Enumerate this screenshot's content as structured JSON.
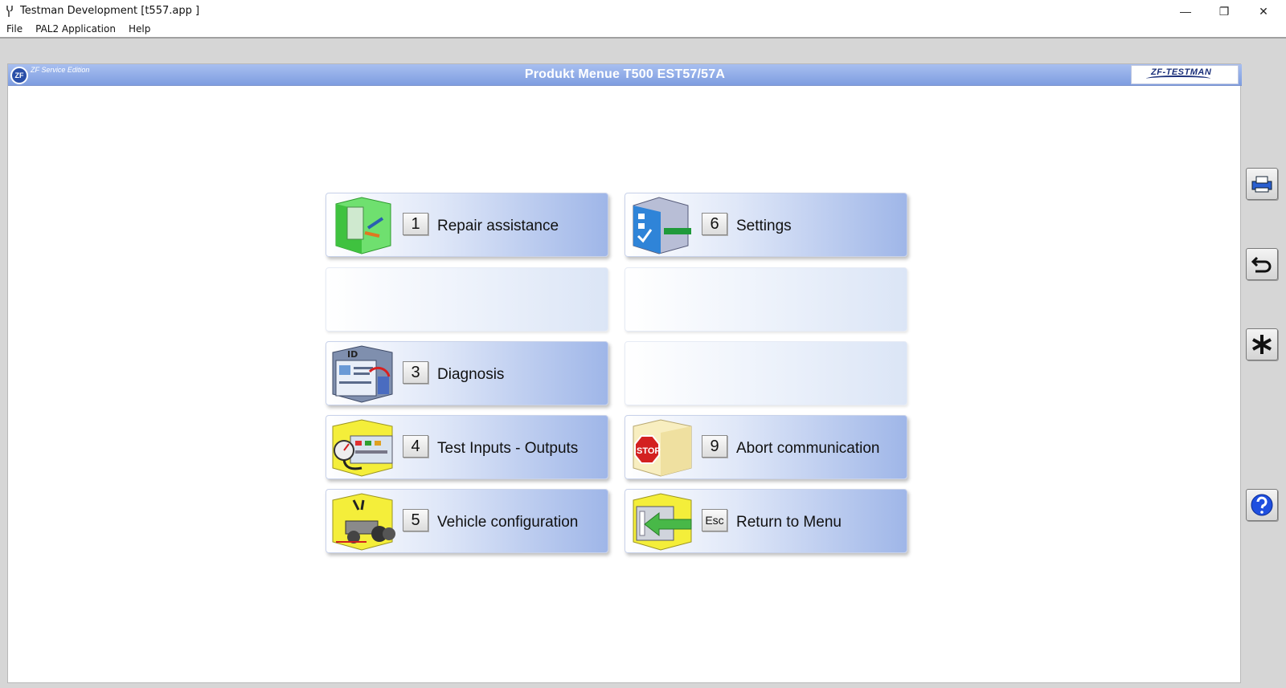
{
  "window": {
    "title": "Testman Development [t557.app     ]",
    "icon": "tool-icon",
    "controls": {
      "minimize": "—",
      "maximize": "❐",
      "close": "✕"
    }
  },
  "menu": {
    "items": [
      "File",
      "PAL2 Application",
      "Help"
    ]
  },
  "header": {
    "badge": "ZF",
    "edition": "ZF Service Edition",
    "title": "Produkt Menue T500 EST57/57A",
    "logo": "ZF-TESTMAN"
  },
  "tiles": [
    {
      "key": "1",
      "label": "Repair assistance",
      "icon": "repair-assistance-icon"
    },
    {
      "key": "6",
      "label": "Settings",
      "icon": "settings-icon"
    },
    {
      "key": "3",
      "label": "Diagnosis",
      "icon": "diagnosis-icon"
    },
    {
      "key": "4",
      "label": "Test Inputs - Outputs",
      "icon": "test-io-icon"
    },
    {
      "key": "9",
      "label": "Abort communication",
      "icon": "stop-icon"
    },
    {
      "key": "5",
      "label": "Vehicle configuration",
      "icon": "vehicle-configuration-icon"
    },
    {
      "key": "Esc",
      "label": "Return to Menu",
      "icon": "return-menu-icon"
    }
  ],
  "stop_text": "STOP",
  "sidebar": [
    "print-icon",
    "undo-icon",
    "asterisk-icon",
    "help-icon"
  ],
  "colors": {
    "header": "#8aa6e4",
    "accent": "#2a4fa8",
    "stop": "#d32020"
  }
}
